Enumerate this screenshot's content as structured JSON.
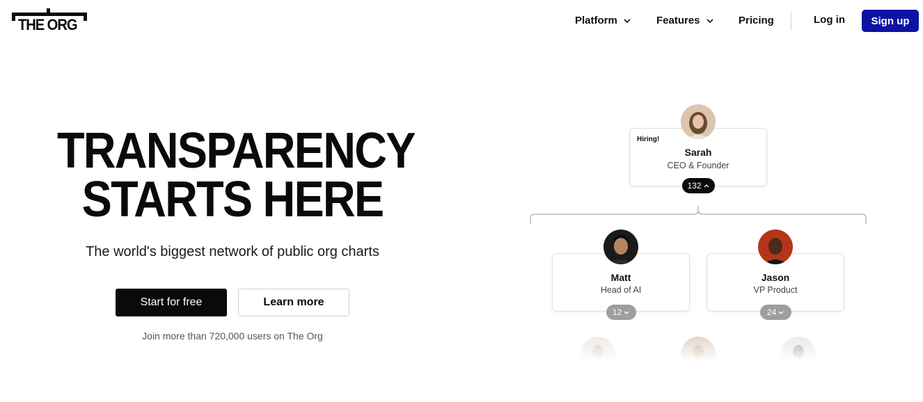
{
  "header": {
    "logo_text": "THE ORG",
    "nav": {
      "platform": "Platform",
      "features": "Features",
      "pricing": "Pricing",
      "login": "Log in",
      "signup": "Sign up"
    },
    "accent_color": "#0d12a3"
  },
  "hero": {
    "title_line1": "TRANSPARENCY",
    "title_line2": "STARTS HERE",
    "subtitle": "The world's biggest network of public org charts",
    "cta_primary": "Start for free",
    "cta_secondary": "Learn more",
    "join_text": "Join more than 720,000 users on The Org"
  },
  "org_chart": {
    "ceo": {
      "badge": "Hiring!",
      "name": "Sarah",
      "role": "CEO & Founder",
      "reports_count": "132",
      "expanded": true
    },
    "reports": [
      {
        "name": "Matt",
        "role": "Head of AI",
        "reports_count": "12",
        "expanded": false
      },
      {
        "name": "Jason",
        "role": "VP Product",
        "reports_count": "24",
        "expanded": false
      }
    ]
  }
}
